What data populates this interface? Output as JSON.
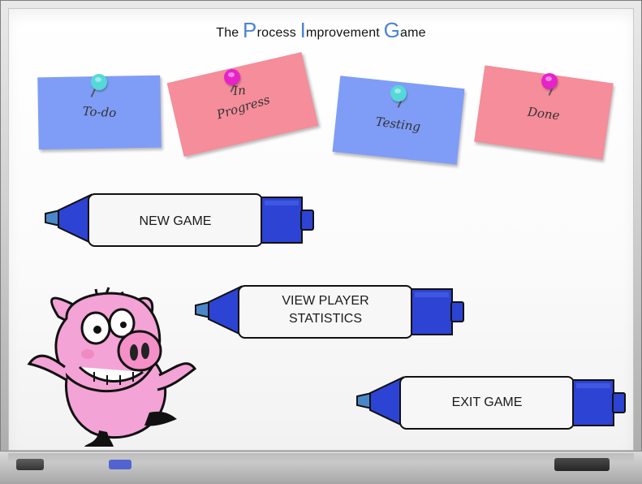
{
  "title": {
    "part1": "The",
    "p": "P",
    "part2": "rocess",
    "i": "I",
    "part3": "mprovement",
    "g": "G",
    "part4": "ame"
  },
  "notes": [
    {
      "id": "todo",
      "label": "To-do",
      "color": "#7f9df6",
      "pin_color": "#55d8d8"
    },
    {
      "id": "in_progress",
      "label_line1": "In",
      "label_line2": "Progress",
      "color": "#f58d9a",
      "pin_color": "#e623c9"
    },
    {
      "id": "testing",
      "label": "Testing",
      "color": "#7f9df6",
      "pin_color": "#55d8d8"
    },
    {
      "id": "done",
      "label": "Done",
      "color": "#f58d9a",
      "pin_color": "#e623c9"
    }
  ],
  "menu": {
    "new_game": "NEW GAME",
    "view_stats": "VIEW PLAYER\nSTATISTICS",
    "exit_game": "EXIT GAME"
  },
  "colors": {
    "marker_blue": "#2c43d4",
    "marker_blue_dark": "#172aa0",
    "marker_tip": "#4b87c8"
  },
  "icons": {
    "pig": "pig-icon",
    "marker": "marker-icon"
  }
}
